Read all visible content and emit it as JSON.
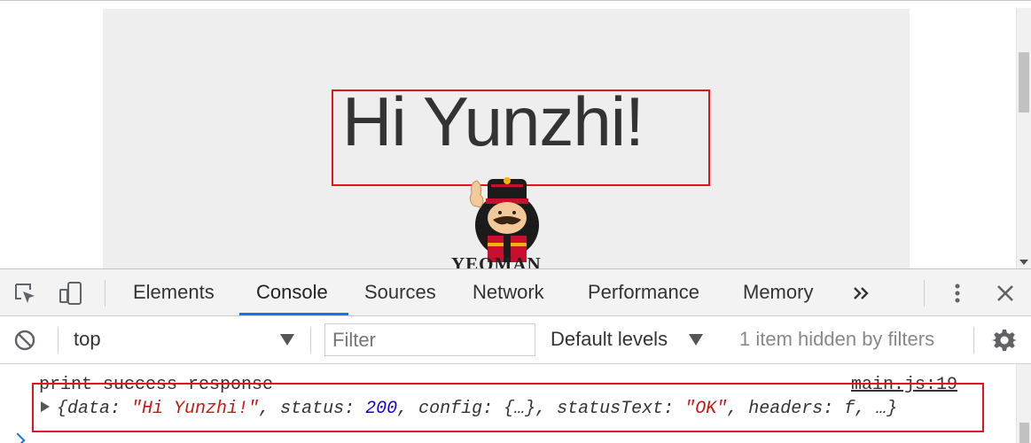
{
  "page": {
    "heading": "Hi Yunzhi!",
    "logo_text": "YEOMAN"
  },
  "devtools": {
    "tabs": [
      "Elements",
      "Console",
      "Sources",
      "Network",
      "Performance",
      "Memory"
    ],
    "active_tab": "Console",
    "more_tabs_icon": "double-chevron-right-icon",
    "menu_icon": "vertical-ellipsis-icon",
    "close_icon": "close-icon",
    "filterbar": {
      "context": "top",
      "filter_placeholder": "Filter",
      "levels": "Default levels",
      "hidden_info": "1 item hidden by filters"
    },
    "console": {
      "message": "print success response",
      "source": "main.js:19",
      "object_open": "{",
      "k_data": "data: ",
      "v_data": "\"Hi Yunzhi!\"",
      "k_status": ", status: ",
      "v_status": "200",
      "k_config": ", config: ",
      "v_config": "{…}",
      "k_statusText": ", statusText: ",
      "v_statusText": "\"OK\"",
      "k_headers": ", headers: ",
      "v_headers": "f",
      "object_close": ", …}"
    }
  },
  "colors": {
    "highlight": "#e0141e",
    "accent": "#1a73e8",
    "string": "#c41a16",
    "number": "#1c00cf"
  }
}
